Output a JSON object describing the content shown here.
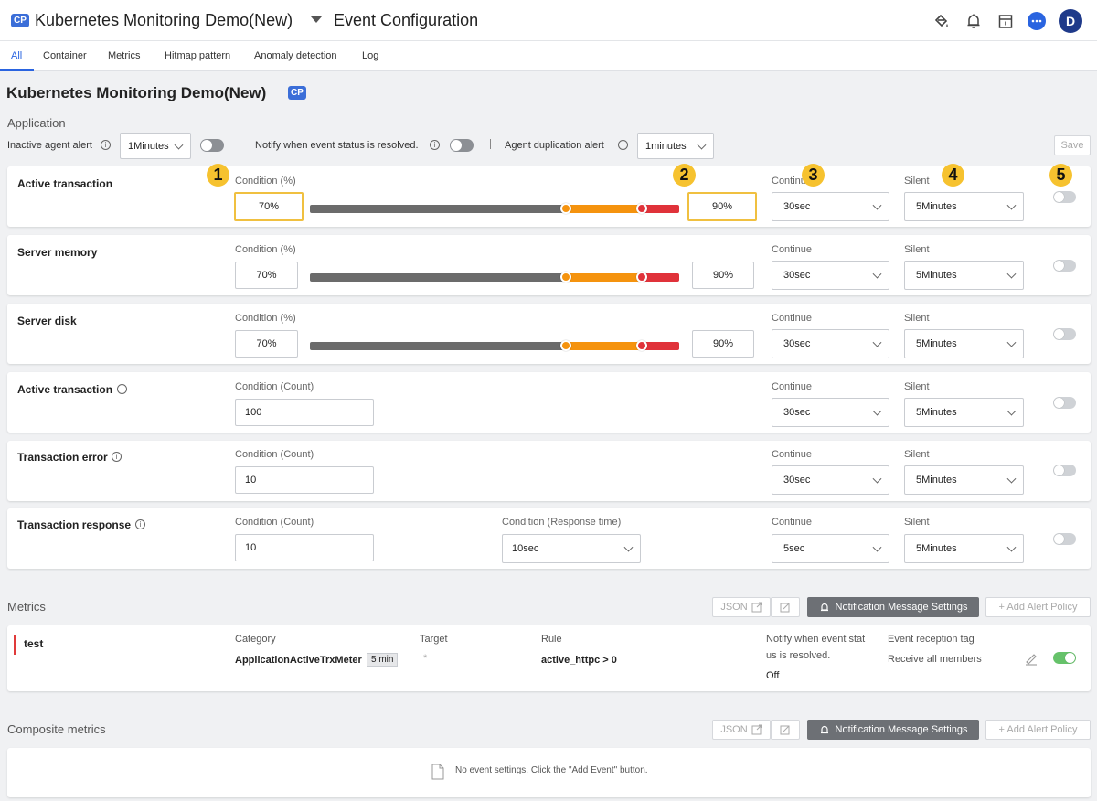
{
  "header": {
    "badge": "CP",
    "project_name": "Kubernetes Monitoring Demo(New)",
    "page_title": "Event Configuration",
    "avatar_letter": "D",
    "icons": [
      "paint-bucket-icon",
      "bell-icon",
      "calendar-icon",
      "chat-icon",
      "avatar"
    ]
  },
  "tabs": [
    "All",
    "Container",
    "Metrics",
    "Hitmap pattern",
    "Anomaly detection",
    "Log"
  ],
  "app": {
    "title": "Kubernetes Monitoring Demo(New)",
    "badge": "CP"
  },
  "application": {
    "section_label": "Application",
    "inactive_alert_label": "Inactive agent alert",
    "inactive_alert_value": "1Minutes",
    "notify_resolved_label": "Notify when event status is resolved.",
    "dup_alert_label": "Agent duplication alert",
    "dup_alert_value": "1minutes",
    "save_label": "Save"
  },
  "rows": [
    {
      "title": "Active transaction",
      "cond_label": "Condition (%)",
      "warn": "70%",
      "crit": "90%",
      "warn_pct": 70,
      "crit_pct": 90,
      "continue_label": "Continue",
      "continue": "30sec",
      "silent_label": "Silent",
      "silent": "5Minutes",
      "enabled": false
    },
    {
      "title": "Server memory",
      "cond_label": "Condition (%)",
      "warn": "70%",
      "crit": "90%",
      "warn_pct": 70,
      "crit_pct": 90,
      "continue_label": "Continue",
      "continue": "30sec",
      "silent_label": "Silent",
      "silent": "5Minutes",
      "enabled": false
    },
    {
      "title": "Server disk",
      "cond_label": "Condition (%)",
      "warn": "70%",
      "crit": "90%",
      "warn_pct": 70,
      "crit_pct": 90,
      "continue_label": "Continue",
      "continue": "30sec",
      "silent_label": "Silent",
      "silent": "5Minutes",
      "enabled": false
    },
    {
      "title": "Active transaction",
      "cond_label": "Condition (Count)",
      "count": "100",
      "continue_label": "Continue",
      "continue": "30sec",
      "silent_label": "Silent",
      "silent": "5Minutes",
      "enabled": false
    },
    {
      "title": "Transaction error",
      "cond_label": "Condition (Count)",
      "count": "10",
      "continue_label": "Continue",
      "continue": "30sec",
      "silent_label": "Silent",
      "silent": "5Minutes",
      "enabled": false
    },
    {
      "title": "Transaction response",
      "cond_label": "Condition (Count)",
      "count": "10",
      "resp_label": "Condition (Response time)",
      "resp_value": "10sec",
      "continue_label": "Continue",
      "continue": "5sec",
      "silent_label": "Silent",
      "silent": "5Minutes",
      "enabled": false
    }
  ],
  "markers": [
    "1",
    "2",
    "3",
    "4",
    "5"
  ],
  "metrics": {
    "section_label": "Metrics",
    "json_label": "JSON",
    "notif_label": "Notification Message Settings",
    "add_label": "+ Add Alert Policy",
    "item": {
      "name": "test",
      "category_label": "Category",
      "category_value": "ApplicationActiveTrxMeter",
      "interval": "5 min",
      "target_label": "Target",
      "target_value": "*",
      "rule_label": "Rule",
      "rule_value": "active_httpc > 0",
      "notify_label_1": "Notify when event stat",
      "notify_label_2": "us is resolved.",
      "notify_value": "Off",
      "tag_label": "Event reception tag",
      "tag_value": "Receive all members",
      "enabled": true
    }
  },
  "composite": {
    "section_label": "Composite metrics",
    "json_label": "JSON",
    "notif_label": "Notification Message Settings",
    "add_label": "+ Add Alert Policy",
    "empty_text": "No event settings. Click the \"Add Event\" button."
  },
  "colors": {
    "accent": "#2a64e0",
    "warning": "#f5930e",
    "critical": "#e0323a",
    "normal": "#6b6b6b",
    "toggle_on": "#66c26a",
    "marker": "#f6c22f"
  }
}
